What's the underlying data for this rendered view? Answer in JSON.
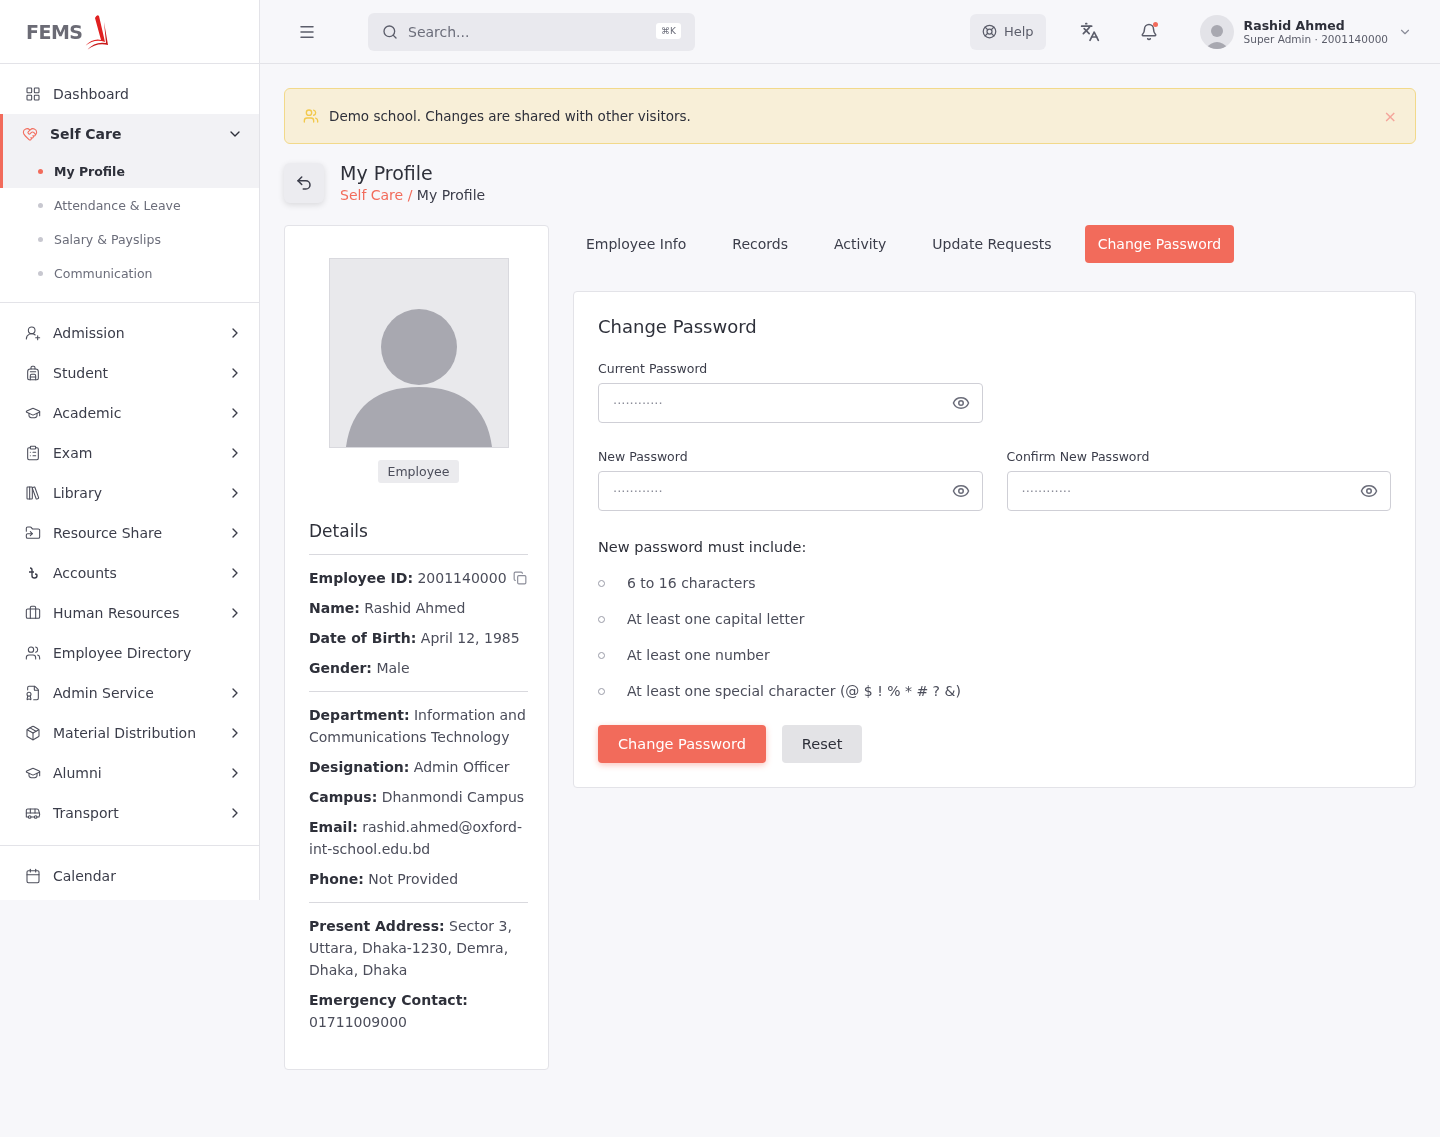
{
  "logo": {
    "text": "FEMS"
  },
  "sidebar": {
    "items": [
      {
        "label": "Dashboard",
        "selected": false,
        "kind": "link"
      },
      {
        "label": "Self Care",
        "selected": true,
        "kind": "submenu",
        "expanded": true,
        "children": [
          {
            "label": "My Profile",
            "selected": true
          },
          {
            "label": "Attendance & Leave",
            "selected": false
          },
          {
            "label": "Salary & Payslips",
            "selected": false
          },
          {
            "label": "Communication",
            "selected": false
          }
        ]
      }
    ],
    "modules": [
      {
        "label": "Admission",
        "kind": "submenu",
        "expanded": false
      },
      {
        "label": "Student",
        "kind": "submenu",
        "expanded": false
      },
      {
        "label": "Academic",
        "kind": "submenu",
        "expanded": false
      },
      {
        "label": "Exam",
        "kind": "submenu",
        "expanded": false
      },
      {
        "label": "Library",
        "kind": "submenu",
        "expanded": false
      },
      {
        "label": "Resource Share",
        "kind": "submenu",
        "expanded": false
      },
      {
        "label": "Accounts",
        "kind": "submenu",
        "expanded": false
      },
      {
        "label": "Human Resources",
        "kind": "submenu",
        "expanded": false
      },
      {
        "label": "Employee Directory",
        "kind": "link"
      },
      {
        "label": "Admin Service",
        "kind": "submenu",
        "expanded": false
      },
      {
        "label": "Material Distribution",
        "kind": "submenu",
        "expanded": false
      },
      {
        "label": "Alumni",
        "kind": "submenu",
        "expanded": false
      },
      {
        "label": "Transport",
        "kind": "submenu",
        "expanded": false
      }
    ],
    "footer_items": [
      {
        "label": "Calendar"
      }
    ]
  },
  "topbar": {
    "search": {
      "placeholder": "Search...",
      "shortcut": "⌘K"
    },
    "help": "Help",
    "notification_dot": true,
    "user": {
      "name": "Rashid Ahmed",
      "role": "Super Admin · 2001140000"
    }
  },
  "banner": {
    "text": "Demo school. Changes are shared with other visitors.",
    "close": "×"
  },
  "page": {
    "title": "My Profile",
    "breadcrumb_separator": "/",
    "breadcrumb": [
      {
        "label": "Self Care",
        "link": true
      },
      {
        "label": "My Profile",
        "link": false
      }
    ]
  },
  "profile": {
    "badge": "Employee",
    "details_title": "Details",
    "groups": [
      [
        "**Employee ID:** 2001140000",
        "**Name:** Rashid Ahmed",
        "**Date of Birth:** April 12, 1985",
        "**Gender:** Male"
      ],
      [
        "**Department:** Information and Communications Technology",
        "**Designation:** Admin Officer",
        "**Campus:** Dhanmondi Campus",
        "**Email:** rashid.ahmed@oxford-int-school.edu.bd",
        "**Phone:** Not Provided"
      ],
      [
        "**Present Address:** Sector 3, Uttara, Dhaka-1230, Demra, Dhaka, Dhaka",
        "**Emergency Contact:** 01711009000"
      ]
    ]
  },
  "tabs": [
    {
      "label": "Employee Info",
      "selected": false
    },
    {
      "label": "Records",
      "selected": false
    },
    {
      "label": "Activity",
      "selected": false
    },
    {
      "label": "Update Requests",
      "selected": false
    },
    {
      "label": "Change Password",
      "selected": true
    }
  ],
  "form": {
    "title": "Change Password",
    "fields": [
      {
        "label": "Current Password",
        "placeholder": "············"
      },
      {
        "label": "New Password",
        "placeholder": "············"
      },
      {
        "label": "Confirm New Password",
        "placeholder": "············"
      }
    ],
    "rules_title": "New password must include:",
    "rules": [
      {
        "text": "6 to 16 characters",
        "met": false
      },
      {
        "text": "At least one capital letter",
        "met": false
      },
      {
        "text": "At least one number",
        "met": false
      },
      {
        "text": "At least one special character (@ $ ! % * # ? &)",
        "met": false
      }
    ],
    "buttons": [
      {
        "label": "Change Password",
        "kind": "primary"
      },
      {
        "label": "Reset",
        "kind": "secondary"
      }
    ]
  }
}
